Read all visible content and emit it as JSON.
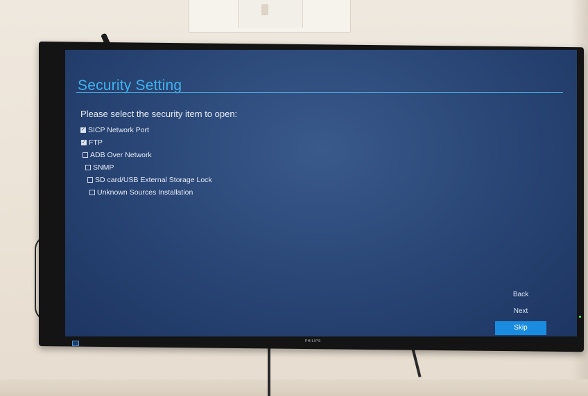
{
  "screen": {
    "title": "Security Setting",
    "prompt": "Please select the security item to open:",
    "options": [
      {
        "label": "SICP Network Port",
        "checked": true
      },
      {
        "label": "FTP",
        "checked": true
      },
      {
        "label": "ADB Over Network",
        "checked": false
      },
      {
        "label": "SNMP",
        "checked": false
      },
      {
        "label": "SD card/USB External Storage Lock",
        "checked": false
      },
      {
        "label": "Unknown Sources Installation",
        "checked": false
      }
    ],
    "nav": {
      "back_label": "Back",
      "next_label": "Next",
      "skip_label": "Skip"
    }
  },
  "monitor": {
    "brand": "PHILIPS"
  },
  "colors": {
    "title": "#3fb2ec",
    "screen_bg": "#2b4878",
    "active_button": "#1a8ce0",
    "bezel": "#141414"
  }
}
